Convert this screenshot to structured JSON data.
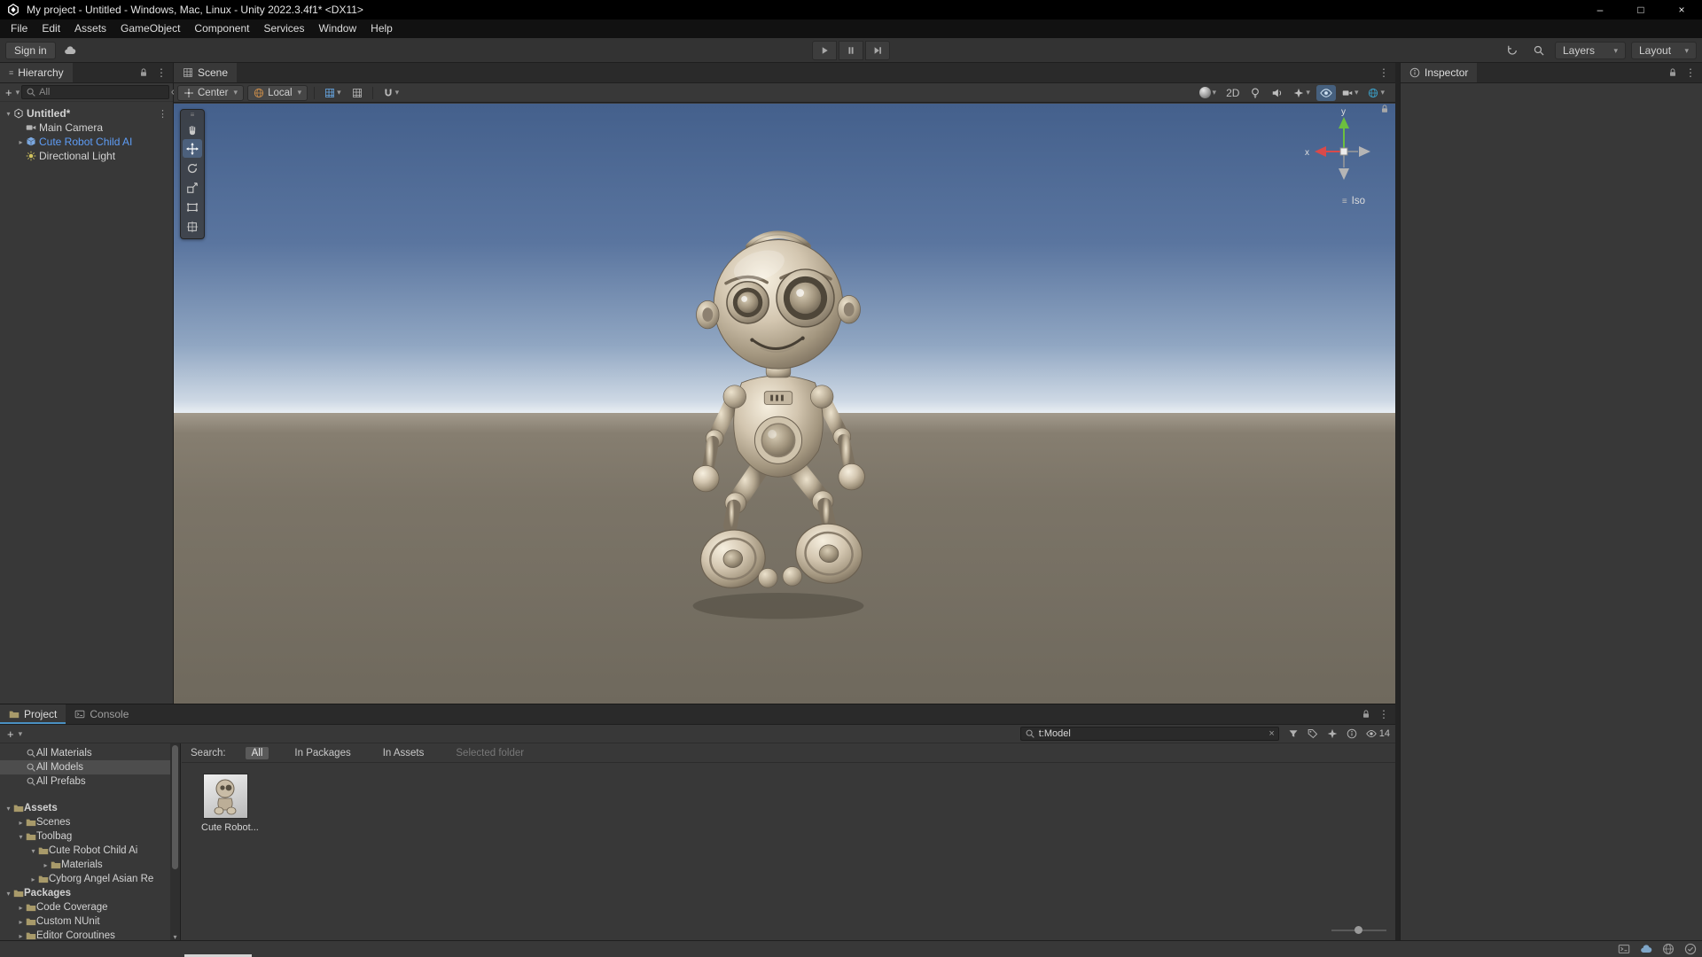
{
  "icons": {
    "kebab": "⋮",
    "caret": "▾",
    "tree_open": "▾",
    "tree_closed": "▸",
    "plus": "+",
    "minimize": "–",
    "maximize": "□",
    "close": "×",
    "menu_lines": "≡",
    "clear": "×"
  },
  "window": {
    "title": "My project - Untitled - Windows, Mac, Linux - Unity 2022.3.4f1* <DX11>"
  },
  "menu": {
    "items": [
      {
        "label": "File"
      },
      {
        "label": "Edit"
      },
      {
        "label": "Assets"
      },
      {
        "label": "GameObject"
      },
      {
        "label": "Component"
      },
      {
        "label": "Services"
      },
      {
        "label": "Window"
      },
      {
        "label": "Help"
      }
    ]
  },
  "toolbar": {
    "sign_in": "Sign in",
    "layers": "Layers",
    "layout": "Layout"
  },
  "hierarchy": {
    "title": "Hierarchy",
    "search_placeholder": "All",
    "scene_label": "Untitled*",
    "items": [
      {
        "label": "Main Camera"
      },
      {
        "label": "Cute Robot Child AI"
      },
      {
        "label": "Directional Light"
      }
    ]
  },
  "scene": {
    "tab": "Scene",
    "pivot": "Center",
    "orientation": "Local",
    "two_d": "2D",
    "iso": "Iso",
    "axis_x": "x",
    "axis_y": "y"
  },
  "inspector": {
    "title": "Inspector"
  },
  "project": {
    "tab": "Project",
    "console_tab": "Console",
    "search_value": "t:Model",
    "hidden_count": "14",
    "scope_label": "Search:",
    "scopes": {
      "all": "All",
      "in_packages": "In Packages",
      "in_assets": "In Assets",
      "selected_folder": "Selected folder"
    },
    "tree": [
      {
        "label": "All Materials"
      },
      {
        "label": "All Models"
      },
      {
        "label": "All Prefabs"
      },
      {
        "label": "Assets"
      },
      {
        "label": "Scenes"
      },
      {
        "label": "Toolbag"
      },
      {
        "label": "Cute Robot Child Ai"
      },
      {
        "label": "Materials"
      },
      {
        "label": "Cyborg Angel Asian Re"
      },
      {
        "label": "Packages"
      },
      {
        "label": "Code Coverage"
      },
      {
        "label": "Custom NUnit"
      },
      {
        "label": "Editor Coroutines"
      }
    ],
    "asset": {
      "label": "Cute Robot..."
    }
  },
  "colors": {
    "selection_blue": "#2c5d87",
    "selected_text": "#5e9cf5",
    "axis_x": "#d94a4a",
    "axis_y": "#6cbf3f"
  }
}
